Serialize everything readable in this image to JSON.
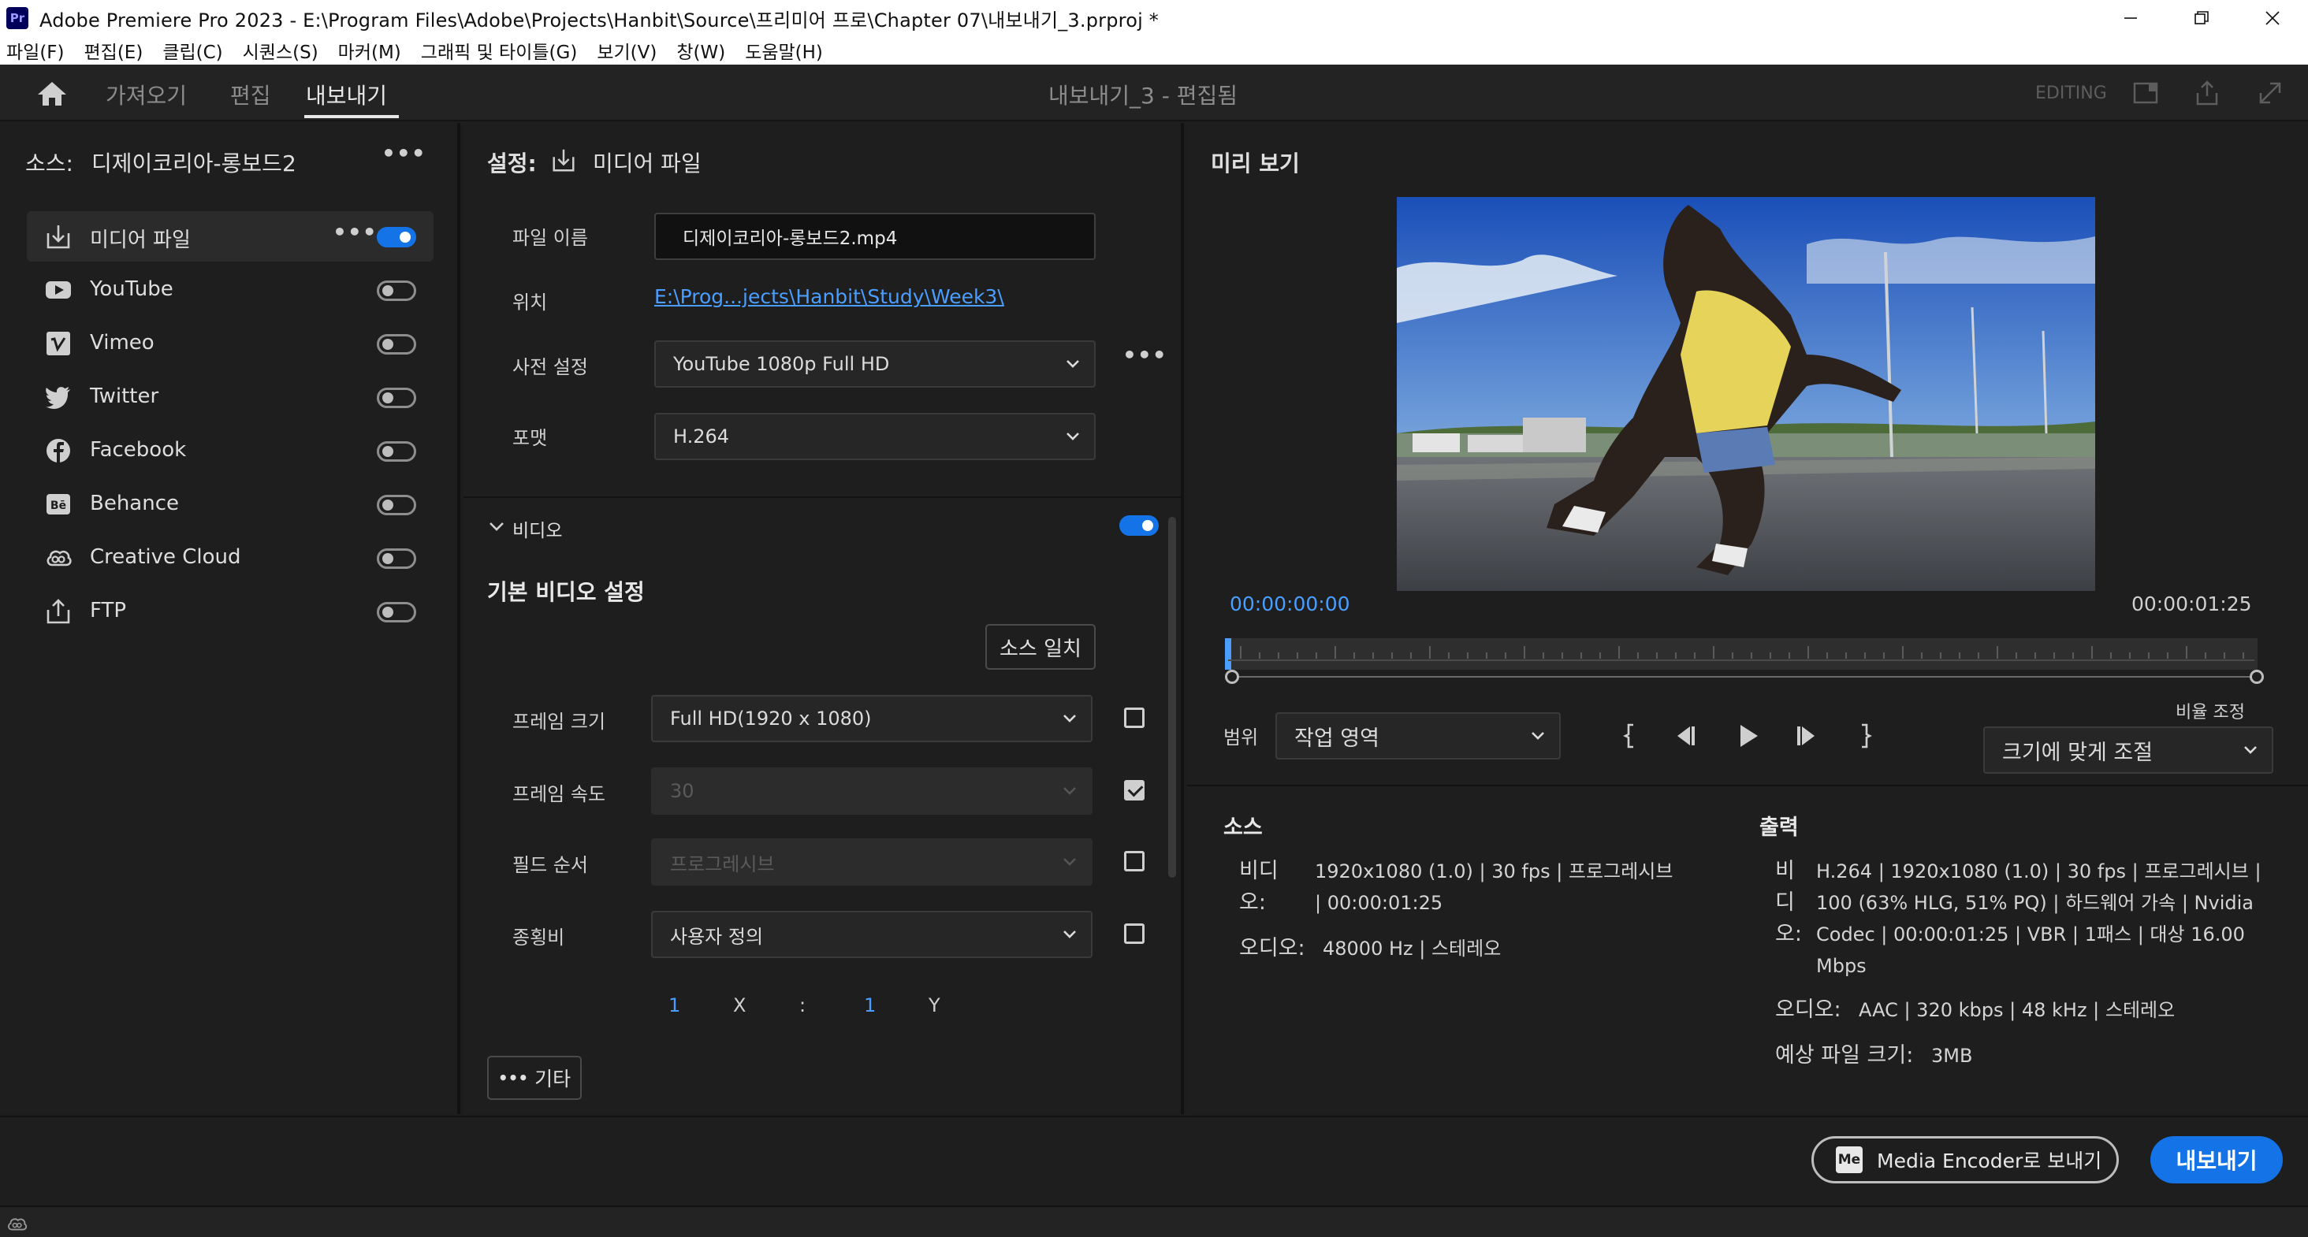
{
  "window": {
    "title": "Adobe Premiere Pro 2023 - E:\\Program Files\\Adobe\\Projects\\Hanbit\\Source\\프리미어 프로\\Chapter 07\\내보내기_3.prproj *"
  },
  "menu": [
    "파일(F)",
    "편집(E)",
    "클립(C)",
    "시퀀스(S)",
    "마커(M)",
    "그래픽 및 타이틀(G)",
    "보기(V)",
    "창(W)",
    "도움말(H)"
  ],
  "header": {
    "tabs": [
      "가져오기",
      "편집",
      "내보내기"
    ],
    "active_tab": "내보내기",
    "project_title": "내보내기_3 - 편집됨",
    "workspace_label": "EDITING"
  },
  "source": {
    "label": "소스:",
    "name": "디제이코리아-롱보드2"
  },
  "destinations": [
    {
      "label": "미디어 파일",
      "icon": "export-file-icon",
      "enabled": true
    },
    {
      "label": "YouTube",
      "icon": "youtube-icon",
      "enabled": false
    },
    {
      "label": "Vimeo",
      "icon": "vimeo-icon",
      "enabled": false
    },
    {
      "label": "Twitter",
      "icon": "twitter-icon",
      "enabled": false
    },
    {
      "label": "Facebook",
      "icon": "facebook-icon",
      "enabled": false
    },
    {
      "label": "Behance",
      "icon": "behance-icon",
      "enabled": false
    },
    {
      "label": "Creative Cloud",
      "icon": "creative-cloud-icon",
      "enabled": false
    },
    {
      "label": "FTP",
      "icon": "ftp-icon",
      "enabled": false
    }
  ],
  "settings": {
    "label": "설정:",
    "target": "미디어 파일",
    "file_name_label": "파일 이름",
    "file_name": "디제이코리아-롱보드2.mp4",
    "location_label": "위치",
    "location": "E:\\Prog...jects\\Hanbit\\Study\\Week3\\",
    "preset_label": "사전 설정",
    "preset": "YouTube 1080p Full HD",
    "format_label": "포맷",
    "format": "H.264"
  },
  "video": {
    "section_label": "비디오",
    "enabled": true,
    "basic_heading": "기본 비디오 설정",
    "match_source": "소스 일치",
    "frame_size_label": "프레임 크기",
    "frame_size": "Full HD(1920 x 1080)",
    "frame_rate_label": "프레임 속도",
    "frame_rate": "30",
    "field_order_label": "필드 순서",
    "field_order": "프로그레시브",
    "aspect_label": "종횡비",
    "aspect": "사용자 정의",
    "aspect_x_value": "1",
    "aspect_x_label": "X",
    "aspect_sep": ":",
    "aspect_y_value": "1",
    "aspect_y_label": "Y",
    "more_button": "기타",
    "checkboxes": {
      "frame_size": false,
      "frame_rate": true,
      "field_order": false,
      "aspect": false
    }
  },
  "preview": {
    "title": "미리 보기",
    "current_time": "00:00:00:00",
    "duration": "00:00:01:25",
    "range_label": "범위",
    "range_value": "작업 영역",
    "scale_label": "비율 조정",
    "scale_value": "크기에 맞게 조절"
  },
  "info": {
    "source_head": "소스",
    "source_video_label": "비디오:",
    "source_video": "1920x1080 (1.0) | 30 fps | 프로그레시브 | 00:00:01:25",
    "source_audio_label": "오디오:",
    "source_audio": "48000 Hz | 스테레오",
    "output_head": "출력",
    "output_video_label": "비디오:",
    "output_video": "H.264 | 1920x1080 (1.0) | 30 fps | 프로그레시브 | 100 (63% HLG, 51% PQ) | 하드웨어 가속 | Nvidia Codec | 00:00:01:25 | VBR | 1패스 | 대상 16.00 Mbps",
    "output_audio_label": "오디오:",
    "output_audio": "AAC | 320 kbps | 48 kHz | 스테레오",
    "file_size_label": "예상 파일 크기:",
    "file_size": "3MB"
  },
  "footer": {
    "media_encoder_logo": "Me",
    "media_encoder_button": "Media Encoder로 보내기",
    "export_button": "내보내기"
  },
  "colors": {
    "accent": "#1473e6",
    "link": "#4a9eff"
  }
}
